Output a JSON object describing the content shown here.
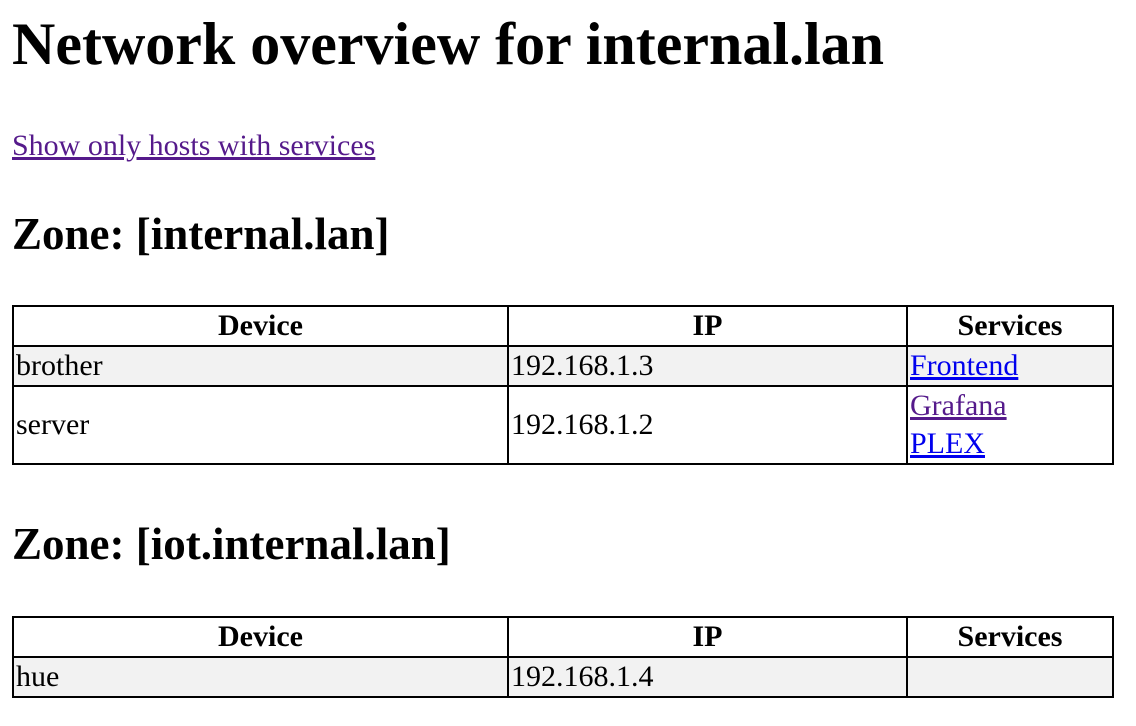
{
  "page": {
    "title": "Network overview for internal.lan",
    "filter_link": "Show only hosts with services"
  },
  "columns": {
    "device": "Device",
    "ip": "IP",
    "services": "Services"
  },
  "zones": [
    {
      "title": "Zone: [internal.lan]",
      "rows": [
        {
          "device": "brother",
          "ip": "192.168.1.3",
          "services": [
            "Frontend"
          ]
        },
        {
          "device": "server",
          "ip": "192.168.1.2",
          "services": [
            "Grafana",
            "PLEX"
          ]
        }
      ]
    },
    {
      "title": "Zone: [iot.internal.lan]",
      "rows": [
        {
          "device": "hue",
          "ip": "192.168.1.4",
          "services": []
        }
      ]
    }
  ],
  "colors": {
    "link_visited": "#551a8b",
    "link_unvisited": "#0000ee",
    "row_stripe": "#f2f2f2"
  }
}
